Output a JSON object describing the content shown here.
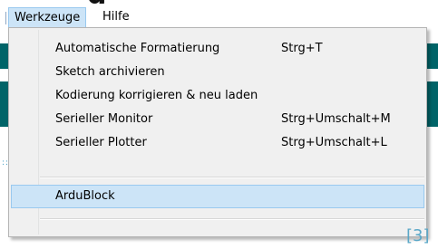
{
  "menubar": {
    "active_menu": "Werkzeuge",
    "next_menu": "Hilfe"
  },
  "menu": {
    "items": [
      {
        "label": "Automatische Formatierung",
        "shortcut": "Strg+T"
      },
      {
        "label": "Sketch archivieren",
        "shortcut": ""
      },
      {
        "label": "Kodierung korrigieren & neu laden",
        "shortcut": ""
      },
      {
        "label": "Serieller Monitor",
        "shortcut": "Strg+Umschalt+M"
      },
      {
        "label": "Serieller Plotter",
        "shortcut": "Strg+Umschalt+L"
      },
      {
        "label": "ArduBlock",
        "shortcut": "",
        "highlighted": true
      }
    ]
  },
  "caption": "[3]",
  "colors": {
    "highlight_bg": "#cce4f7",
    "highlight_border": "#99c9ef",
    "menu_bg": "#f0f0f0",
    "app_teal": "#006468",
    "caption_blue": "#5aa7c7"
  }
}
